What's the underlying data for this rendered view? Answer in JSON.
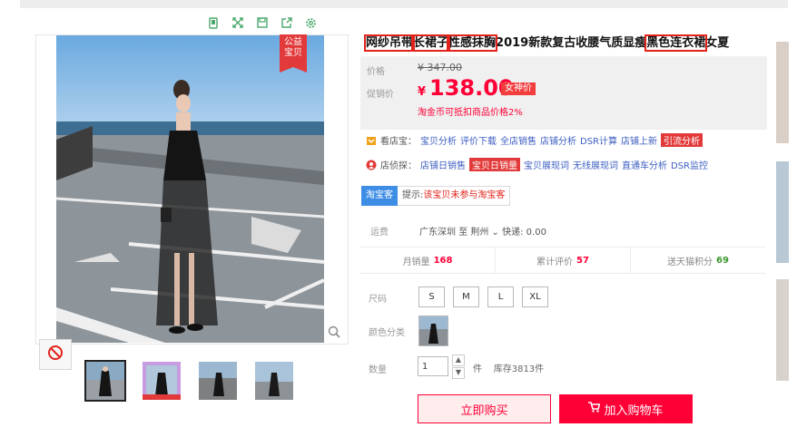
{
  "badge": {
    "line1": "公益",
    "line2": "宝贝"
  },
  "title": {
    "seg1": "网纱吊带",
    "seg2": "长裙子",
    "seg3": "性感抹胸",
    "seg4": "2019新款复古收腰气质显瘦",
    "seg5": "黑色连衣裙",
    "seg6": "女夏"
  },
  "price": {
    "orig_label": "价格",
    "orig_value": "¥ 347.00",
    "promo_label": "促销价",
    "currency": "¥",
    "value": "138.00",
    "tag": "女神价",
    "coin_note": "淘金币可抵扣商品价格2%"
  },
  "tools1": {
    "label": "看店宝：",
    "items": [
      "宝贝分析",
      "评价下载",
      "全店销售",
      "店铺分析",
      "DSR计算",
      "店铺上新"
    ],
    "highlight": "引流分析"
  },
  "tools2": {
    "label": "店侦探：",
    "item1": "店铺日销售",
    "highlight": "宝贝日销量",
    "items": [
      "宝贝展现词",
      "无线展现词",
      "直通车分析",
      "DSR监控"
    ]
  },
  "taoke": {
    "badge": "淘宝客",
    "hint": "提示:",
    "hint_red": "该宝贝未参与淘宝客"
  },
  "shipping": {
    "label": "运费",
    "from": "广东深圳",
    "to_word": "至",
    "dest": "荆州",
    "fee": "快递: 0.00"
  },
  "stats": [
    {
      "label": "月销量",
      "value": "168",
      "color": "#ff0036"
    },
    {
      "label": "累计评价",
      "value": "57",
      "color": "#ff0036"
    },
    {
      "label": "送天猫积分",
      "value": "69",
      "color": "#3c9a2f"
    }
  ],
  "size": {
    "label": "尺码",
    "options": [
      "S",
      "M",
      "L",
      "XL"
    ]
  },
  "color": {
    "label": "颜色分类"
  },
  "qty": {
    "label": "数量",
    "value": "1",
    "unit": "件",
    "stock": "库存3813件"
  },
  "buttons": {
    "buy": "立即购买",
    "cart": "加入购物车"
  },
  "colors": {
    "accent": "#ff0036",
    "taoke_blue": "#3f8ee6",
    "link_blue": "#3c5ec1"
  }
}
